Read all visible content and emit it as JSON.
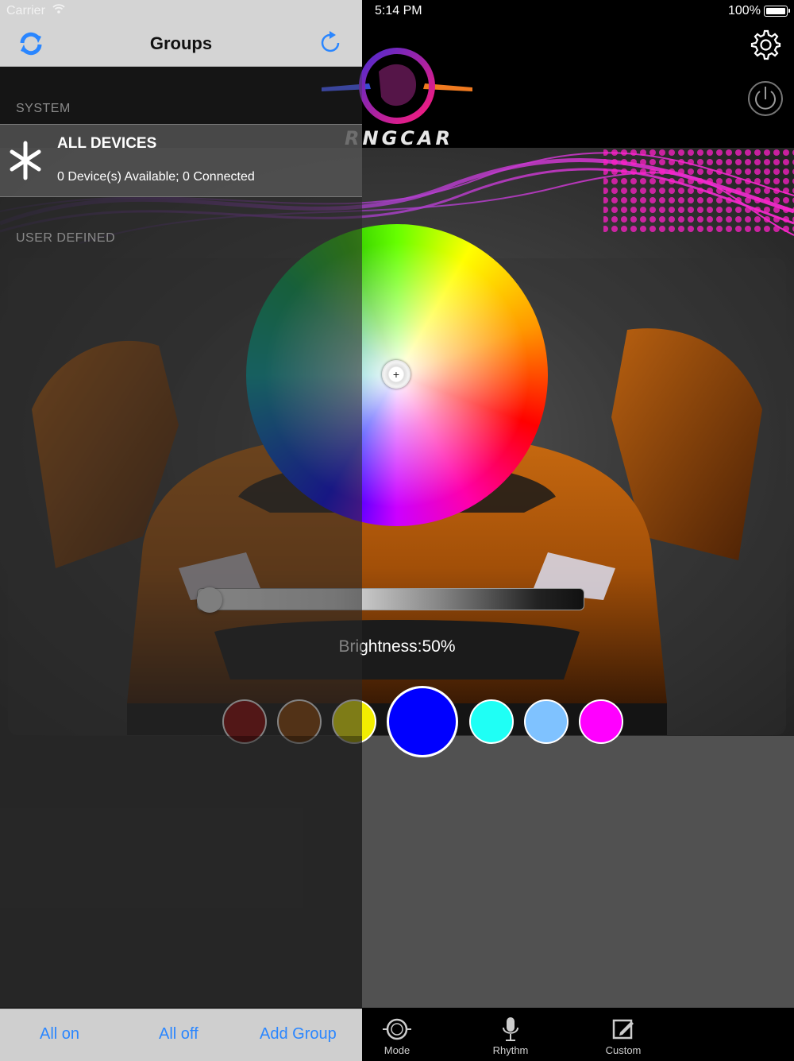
{
  "status_bar": {
    "carrier": "Carrier",
    "time": "5:14 PM",
    "battery": "100%"
  },
  "sidebar": {
    "title": "Groups",
    "section_system": "SYSTEM",
    "all_devices": {
      "title": "ALL DEVICES",
      "subtitle": "0 Device(s) Available; 0 Connected"
    },
    "section_user": "USER DEFINED",
    "toolbar": {
      "all_on": "All on",
      "all_off": "All off",
      "add_group": "Add Group"
    }
  },
  "app": {
    "logo_text": "RNGCAR",
    "brightness_label": "Brightness:50%",
    "brightness_value": 0.5,
    "swatches": [
      {
        "color": "#8b0000",
        "selected": false
      },
      {
        "color": "#8b4000",
        "selected": false
      },
      {
        "color": "#f2ee00",
        "selected": false
      },
      {
        "color": "#0000ff",
        "selected": true
      },
      {
        "color": "#1ffff5",
        "selected": false
      },
      {
        "color": "#7fc2ff",
        "selected": false
      },
      {
        "color": "#ff00ff",
        "selected": false
      }
    ],
    "tabs": [
      {
        "label": "Mode",
        "icon": "mode-icon"
      },
      {
        "label": "Rhythm",
        "icon": "microphone-icon"
      },
      {
        "label": "Custom",
        "icon": "edit-icon"
      }
    ]
  },
  "colors": {
    "accent_blue": "#2a86ff",
    "navbar_bg": "#d4d4d4"
  }
}
